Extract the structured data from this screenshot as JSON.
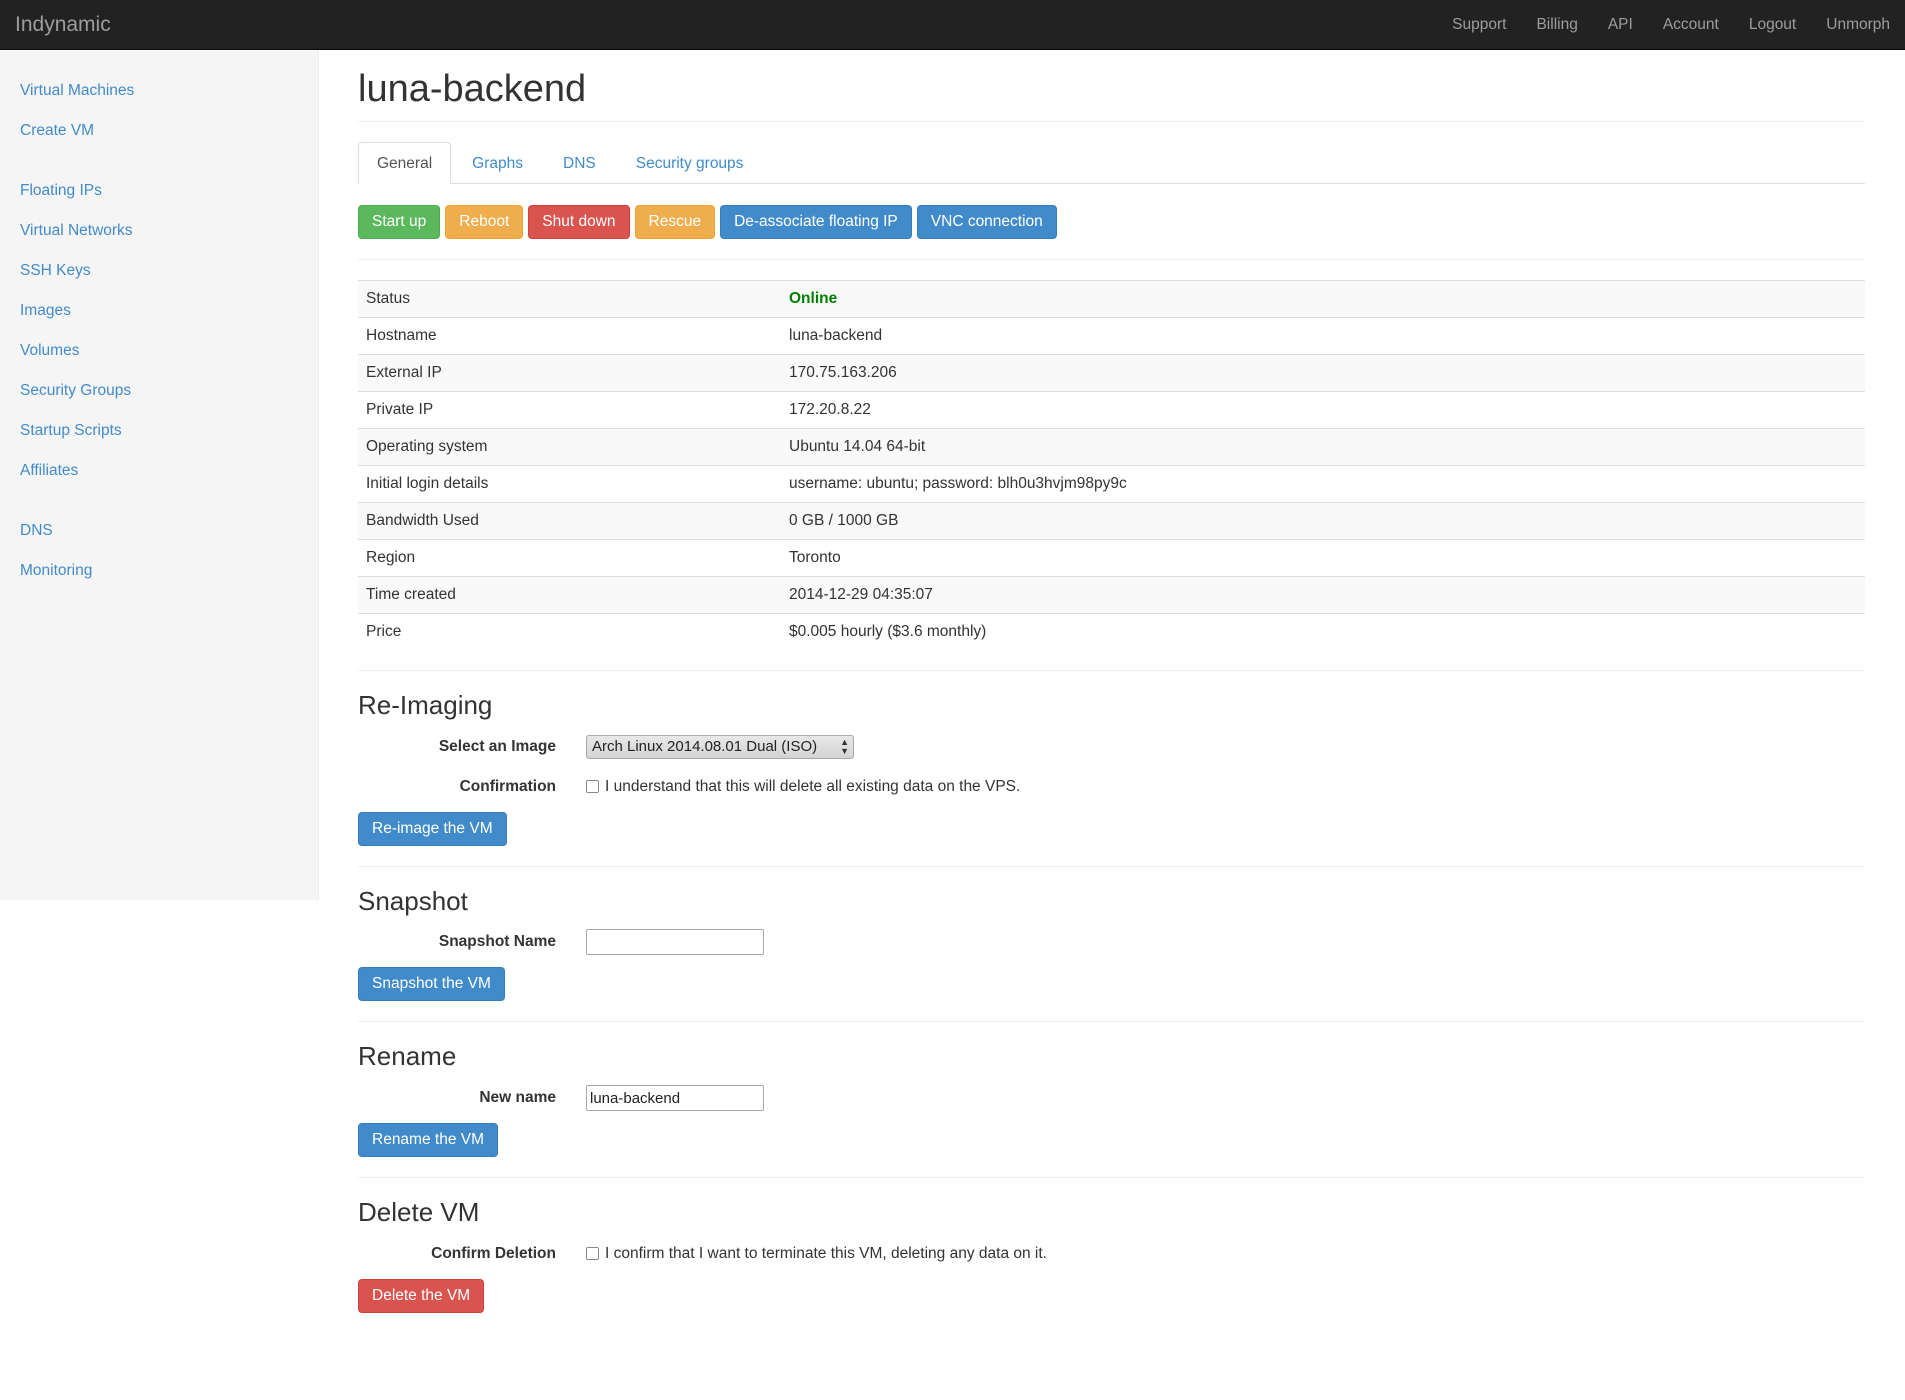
{
  "navbar": {
    "brand": "Indynamic",
    "links": [
      "Support",
      "Billing",
      "API",
      "Account",
      "Logout",
      "Unmorph"
    ]
  },
  "sidebar": {
    "items": [
      "Virtual Machines",
      "Create VM",
      "Floating IPs",
      "Virtual Networks",
      "SSH Keys",
      "Images",
      "Volumes",
      "Security Groups",
      "Startup Scripts",
      "Affiliates",
      "DNS",
      "Monitoring"
    ]
  },
  "main": {
    "title": "luna-backend",
    "tabs": [
      "General",
      "Graphs",
      "DNS",
      "Security groups"
    ],
    "active_tab": "General",
    "actions": {
      "start": "Start up",
      "reboot": "Reboot",
      "shutdown": "Shut down",
      "rescue": "Rescue",
      "deassociate": "De-associate floating IP",
      "vnc": "VNC connection"
    },
    "info_rows": [
      {
        "key": "Status",
        "value": "Online"
      },
      {
        "key": "Hostname",
        "value": "luna-backend"
      },
      {
        "key": "External IP",
        "value": "170.75.163.206"
      },
      {
        "key": "Private IP",
        "value": "172.20.8.22"
      },
      {
        "key": "Operating system",
        "value": "Ubuntu 14.04 64-bit"
      },
      {
        "key": "Initial login details",
        "value": "username: ubuntu; password: blh0u3hvjm98py9c"
      },
      {
        "key": "Bandwidth Used",
        "value": "0 GB / 1000 GB"
      },
      {
        "key": "Region",
        "value": "Toronto"
      },
      {
        "key": "Time created",
        "value": "2014-12-29 04:35:07"
      },
      {
        "key": "Price",
        "value": "$0.005 hourly ($3.6 monthly)"
      }
    ],
    "reimage": {
      "heading": "Re-Imaging",
      "select_label": "Select an Image",
      "select_value": "Arch Linux 2014.08.01 Dual (ISO)",
      "confirm_label": "Confirmation",
      "confirm_text": "I understand that this will delete all existing data on the VPS.",
      "button": "Re-image the VM"
    },
    "snapshot": {
      "heading": "Snapshot",
      "name_label": "Snapshot Name",
      "name_value": "",
      "button": "Snapshot the VM"
    },
    "rename": {
      "heading": "Rename",
      "name_label": "New name",
      "name_value": "luna-backend",
      "button": "Rename the VM"
    },
    "delete": {
      "heading": "Delete VM",
      "confirm_label": "Confirm Deletion",
      "confirm_text": "I confirm that I want to terminate this VM, deleting any data on it.",
      "button": "Delete the VM"
    }
  },
  "colors": {
    "navbar_bg": "#222222",
    "link": "#428bca",
    "success": "#5cb85c",
    "warning": "#f0ad4e",
    "danger": "#d9534f",
    "primary": "#428bca",
    "status_online": "#008000"
  }
}
